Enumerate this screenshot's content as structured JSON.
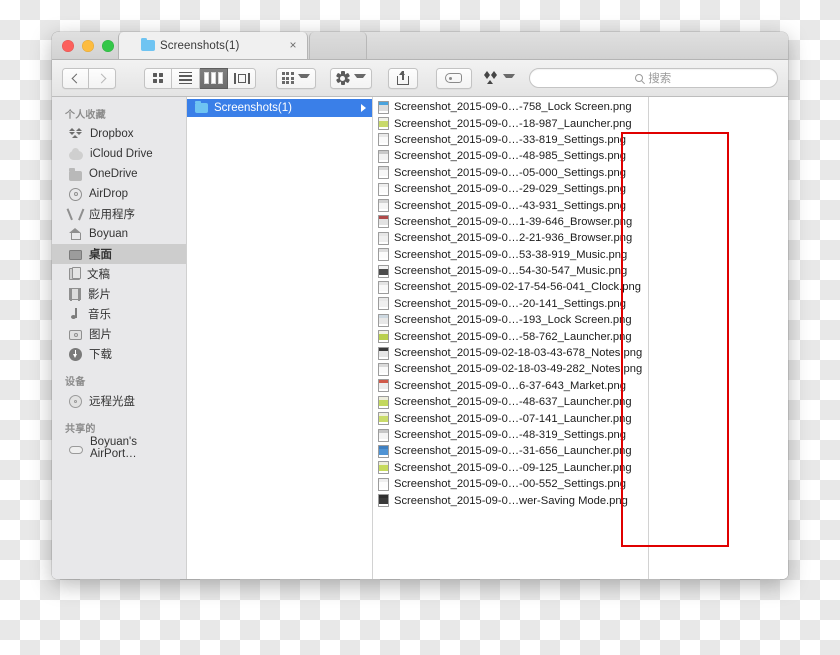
{
  "window": {
    "tab_title": "Screenshots(1)",
    "close_tab_label": "×",
    "traffic_lights": [
      "close",
      "minimize",
      "zoom"
    ]
  },
  "toolbar": {
    "back_label": "",
    "forward_label": "",
    "view_modes": [
      {
        "name": "icon-view",
        "selected": false
      },
      {
        "name": "list-view",
        "selected": false
      },
      {
        "name": "column-view",
        "selected": true
      },
      {
        "name": "gallery-view",
        "selected": false
      }
    ],
    "arrange_label": "",
    "action_label": "",
    "share_label": "",
    "tags_label": "",
    "dropbox_label": "",
    "search": {
      "placeholder": "搜索",
      "value": ""
    }
  },
  "sidebar": {
    "sections": [
      {
        "header": "个人收藏",
        "items": [
          {
            "label": "Dropbox",
            "icon": "dropbox-icon",
            "selected": false
          },
          {
            "label": "iCloud Drive",
            "icon": "cloud-icon",
            "selected": false
          },
          {
            "label": "OneDrive",
            "icon": "folder-icon",
            "selected": false
          },
          {
            "label": "AirDrop",
            "icon": "airdrop-icon",
            "selected": false
          },
          {
            "label": "应用程序",
            "icon": "applications-icon",
            "selected": false
          },
          {
            "label": "Boyuan",
            "icon": "home-icon",
            "selected": false
          },
          {
            "label": "桌面",
            "icon": "desktop-icon",
            "selected": true
          },
          {
            "label": "文稿",
            "icon": "documents-icon",
            "selected": false
          },
          {
            "label": "影片",
            "icon": "movies-icon",
            "selected": false
          },
          {
            "label": "音乐",
            "icon": "music-icon",
            "selected": false
          },
          {
            "label": "图片",
            "icon": "pictures-icon",
            "selected": false
          },
          {
            "label": "下载",
            "icon": "downloads-icon",
            "selected": false
          }
        ]
      },
      {
        "header": "设备",
        "items": [
          {
            "label": "远程光盘",
            "icon": "remote-disc-icon",
            "selected": false
          }
        ]
      },
      {
        "header": "共享的",
        "items": [
          {
            "label": "Boyuan's AirPort…",
            "icon": "airport-icon",
            "selected": false
          }
        ]
      }
    ]
  },
  "column1": {
    "rows": [
      {
        "label": "Screenshots(1)",
        "icon": "folder-icon",
        "selected": true,
        "has_disclosure": true
      }
    ]
  },
  "column2": {
    "files": [
      {
        "name": "Screenshot_2015-09-0…-758_Lock Screen.png",
        "thumb_top": "#4aa3dd",
        "thumb_mid": "#dcdcdc"
      },
      {
        "name": "Screenshot_2015-09-0…-18-987_Launcher.png",
        "thumb_top": "#f2f2ea",
        "thumb_mid": "#c8d96a"
      },
      {
        "name": "Screenshot_2015-09-0…-33-819_Settings.png",
        "thumb_top": "#e8e8e8",
        "thumb_mid": "#fafafa"
      },
      {
        "name": "Screenshot_2015-09-0…-48-985_Settings.png",
        "thumb_top": "#c9c9c9",
        "thumb_mid": "#f2f2f2"
      },
      {
        "name": "Screenshot_2015-09-0…-05-000_Settings.png",
        "thumb_top": "#d8d8d8",
        "thumb_mid": "#f7f7f7"
      },
      {
        "name": "Screenshot_2015-09-0…-29-029_Settings.png",
        "thumb_top": "#ededed",
        "thumb_mid": "#fbfbfb"
      },
      {
        "name": "Screenshot_2015-09-0…-43-931_Settings.png",
        "thumb_top": "#d2d2d2",
        "thumb_mid": "#f5f5f5"
      },
      {
        "name": "Screenshot_2015-09-0…1-39-646_Browser.png",
        "thumb_top": "#b04a4a",
        "thumb_mid": "#e2e2e2"
      },
      {
        "name": "Screenshot_2015-09-0…2-21-936_Browser.png",
        "thumb_top": "#e6e6e6",
        "thumb_mid": "#efefef"
      },
      {
        "name": "Screenshot_2015-09-0…53-38-919_Music.png",
        "thumb_top": "#dedede",
        "thumb_mid": "#fcfcfc"
      },
      {
        "name": "Screenshot_2015-09-0…54-30-547_Music.png",
        "thumb_top": "#f4f4f4",
        "thumb_mid": "#4c4c4c"
      },
      {
        "name": "Screenshot_2015-09-02-17-54-56-041_Clock.png",
        "thumb_top": "#e4e4e4",
        "thumb_mid": "#f8f8f8"
      },
      {
        "name": "Screenshot_2015-09-0…-20-141_Settings.png",
        "thumb_top": "#e9e9e9",
        "thumb_mid": "#f0f0f0"
      },
      {
        "name": "Screenshot_2015-09-0…-193_Lock Screen.png",
        "thumb_top": "#cdd8e0",
        "thumb_mid": "#e8e8e8"
      },
      {
        "name": "Screenshot_2015-09-0…-58-762_Launcher.png",
        "thumb_top": "#f0f0e4",
        "thumb_mid": "#b9cf4e"
      },
      {
        "name": "Screenshot_2015-09-02-18-03-43-678_Notes.png",
        "thumb_top": "#3a3a3a",
        "thumb_mid": "#e6e6e6"
      },
      {
        "name": "Screenshot_2015-09-02-18-03-49-282_Notes.png",
        "thumb_top": "#dadada",
        "thumb_mid": "#fafafa"
      },
      {
        "name": "Screenshot_2015-09-0…6-37-643_Market.png",
        "thumb_top": "#d05a4a",
        "thumb_mid": "#ececec"
      },
      {
        "name": "Screenshot_2015-09-0…-48-637_Launcher.png",
        "thumb_top": "#eeeedd",
        "thumb_mid": "#c3d85e"
      },
      {
        "name": "Screenshot_2015-09-0…-07-141_Launcher.png",
        "thumb_top": "#efefdd",
        "thumb_mid": "#cadc6a"
      },
      {
        "name": "Screenshot_2015-09-0…-48-319_Settings.png",
        "thumb_top": "#c6c6c6",
        "thumb_mid": "#f4f4f4"
      },
      {
        "name": "Screenshot_2015-09-0…-31-656_Launcher.png",
        "thumb_top": "#3f7fc0",
        "thumb_mid": "#4f93d4"
      },
      {
        "name": "Screenshot_2015-09-0…-09-125_Launcher.png",
        "thumb_top": "#eeeedd",
        "thumb_mid": "#c6da5c"
      },
      {
        "name": "Screenshot_2015-09-0…-00-552_Settings.png",
        "thumb_top": "#efefef",
        "thumb_mid": "#fdfdfd"
      },
      {
        "name": "Screenshot_2015-09-0…wer-Saving Mode.png",
        "thumb_top": "#2f2f2f",
        "thumb_mid": "#3a3a3a"
      }
    ]
  },
  "annotation": {
    "color": "#e00000",
    "shape": "rectangle"
  }
}
